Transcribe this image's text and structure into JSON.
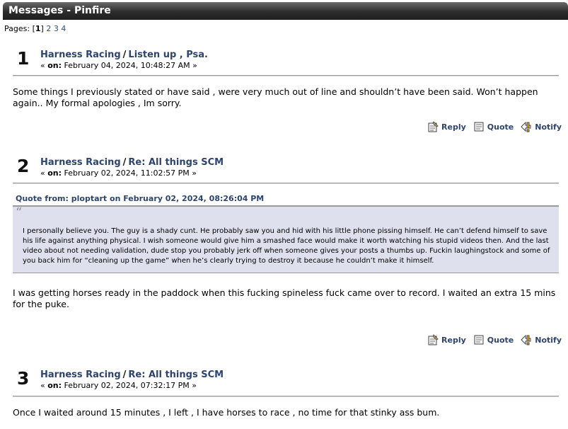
{
  "window": {
    "title": "Messages - Pinfire"
  },
  "pagination": {
    "label": "Pages: ",
    "current": "1",
    "pages": [
      "2",
      "3",
      "4"
    ]
  },
  "actions": {
    "reply": "Reply",
    "quote": "Quote",
    "notify": "Notify"
  },
  "posts": [
    {
      "number": "1",
      "board": "Harness Racing",
      "topic": "Listen up , Psa.",
      "meta_prefix": "« ",
      "on_label": "on:",
      "date": " February 04, 2024, 10:48:27 AM »",
      "body": "Some things I previously stated or have said , were very much out of line and shouldn’t have been said. Won’t happen again.. My formal apologies , Im sorry."
    },
    {
      "number": "2",
      "board": "Harness Racing",
      "topic": "Re: All things SCM",
      "meta_prefix": "« ",
      "on_label": "on:",
      "date": " February 02, 2024, 11:02:57 PM »",
      "quote_header": "Quote from: ploptart on February 02, 2024, 08:26:04 PM",
      "quote_text": "I personally believe you. The guy is a shady cunt. He probably saw you and hid with his little phone pissing himself. He can’t defend himself to save his life against anything physical. I wish someone would give him a smashed face would make it worth watching his stupid videos then. And the last video about not needing validation, dude stop you probably jerk off when someone gives your posts a thumbs up. Fuckin laughingstock and some of you back him for “cleaning up the game” when he’s clearly trying to destroy it because he couldn’t make it himself.",
      "body": "I was getting horses ready in the paddock when this fucking spineless fuck came over to record. I waited an extra 15 mins for the puke."
    },
    {
      "number": "3",
      "board": "Harness Racing",
      "topic": "Re: All things SCM",
      "meta_prefix": "« ",
      "on_label": "on:",
      "date": " February 02, 2024, 07:32:17 PM »",
      "body": "Once I waited around 15 minutes , I left , I have horses to race , no time for that stinky ass bum."
    }
  ]
}
